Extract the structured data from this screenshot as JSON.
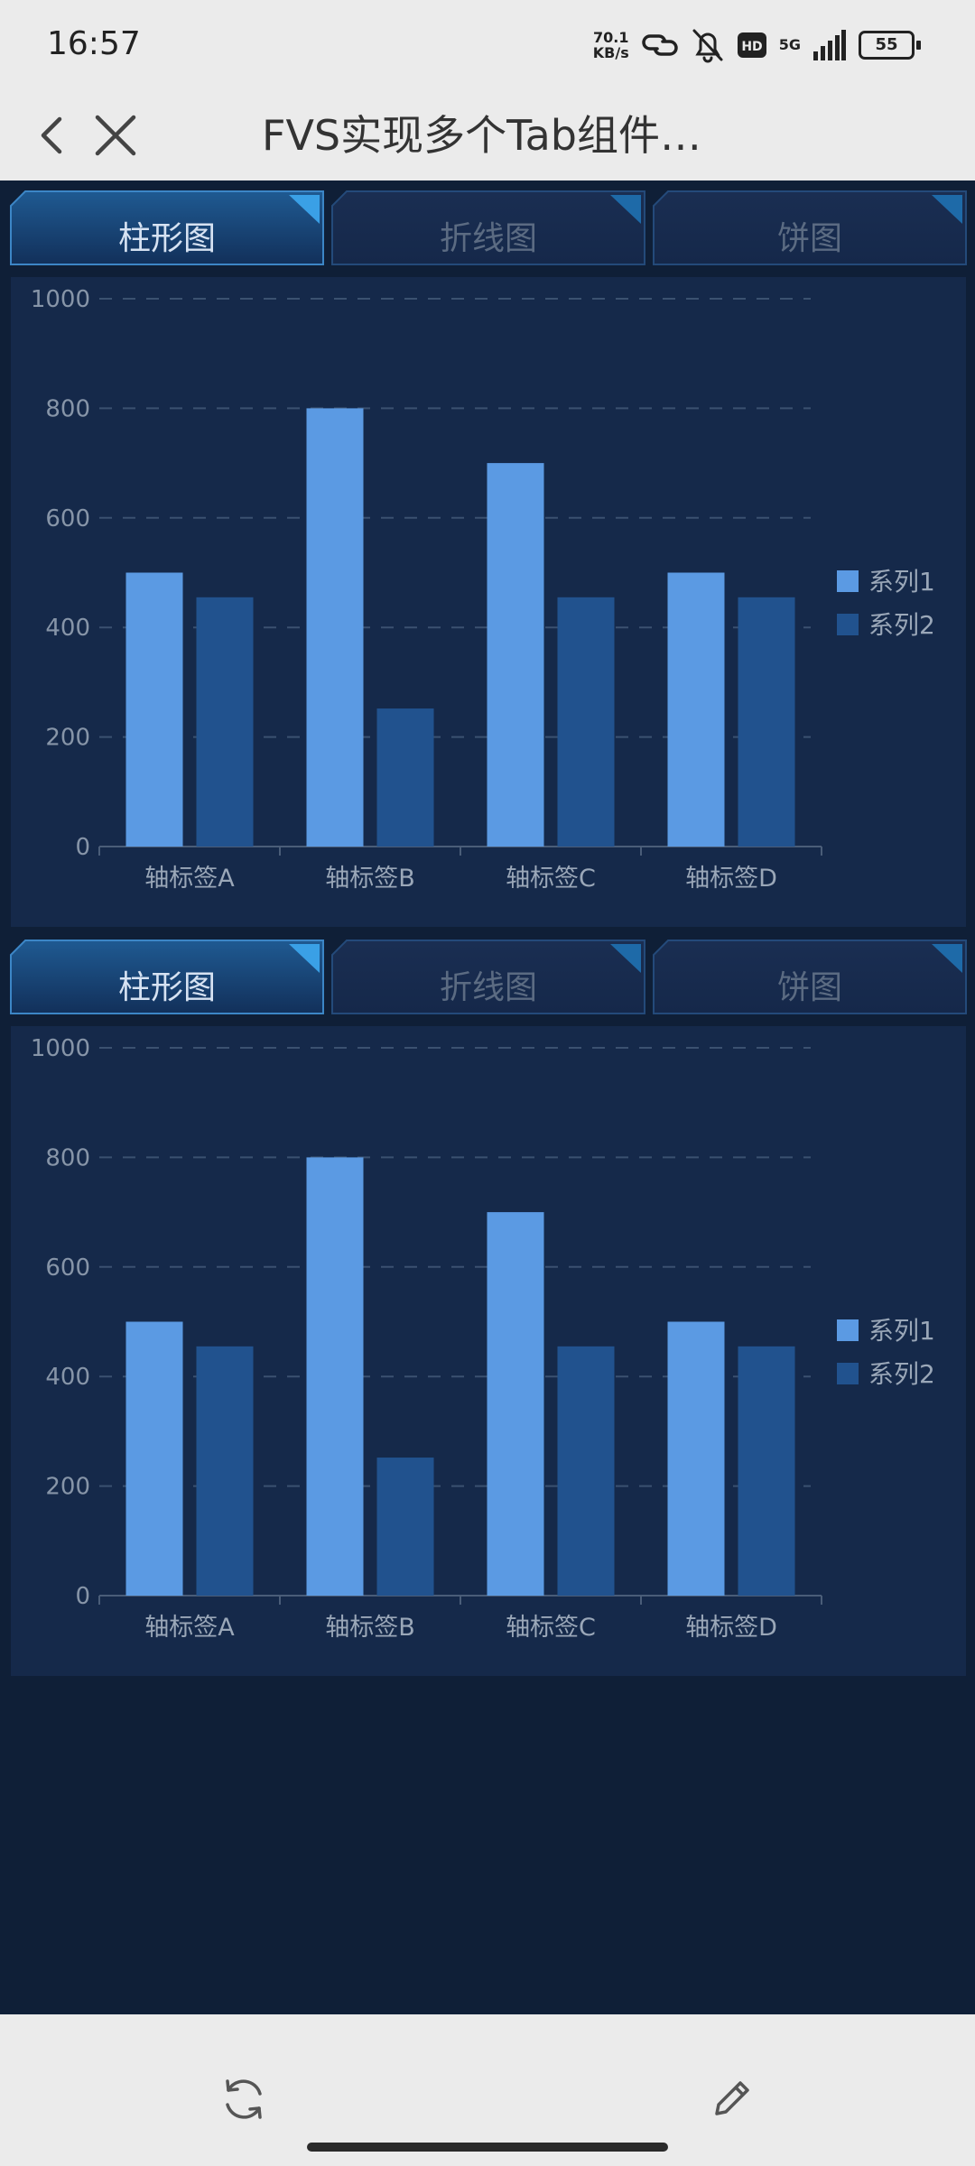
{
  "status_bar": {
    "time": "16:57",
    "net_speed_value": "70.1",
    "net_speed_unit": "KB/s",
    "network": "5G",
    "battery": "55",
    "icons": [
      "link-icon",
      "bell-off-icon",
      "hd-icon",
      "signal-icon",
      "battery-icon"
    ]
  },
  "nav": {
    "title": "FVS实现多个Tab组件…",
    "icons": [
      "back-icon",
      "close-icon"
    ]
  },
  "colors": {
    "series1": "#5b9ae3",
    "series2": "#21528e",
    "tab_active_text": "#d6e2f2",
    "tab_inactive_text": "#5b6b82",
    "panel_bg": "#15294a",
    "page_bg": "#0f1f37"
  },
  "widgets": [
    {
      "tabs": [
        {
          "label": "柱形图",
          "active": true
        },
        {
          "label": "折线图",
          "active": false
        },
        {
          "label": "饼图",
          "active": false
        }
      ]
    },
    {
      "tabs": [
        {
          "label": "柱形图",
          "active": true
        },
        {
          "label": "折线图",
          "active": false
        },
        {
          "label": "饼图",
          "active": false
        }
      ]
    }
  ],
  "chart_data": [
    {
      "type": "bar",
      "categories": [
        "轴标签A",
        "轴标签B",
        "轴标签C",
        "轴标签D"
      ],
      "series": [
        {
          "name": "系列1",
          "values": [
            500,
            800,
            700,
            500
          ]
        },
        {
          "name": "系列2",
          "values": [
            455,
            252,
            455,
            455
          ]
        }
      ],
      "ylim": [
        0,
        1000
      ],
      "yticks": [
        0,
        200,
        400,
        600,
        800,
        1000
      ],
      "grid": "dashed horizontal",
      "legend": "right"
    },
    {
      "type": "bar",
      "categories": [
        "轴标签A",
        "轴标签B",
        "轴标签C",
        "轴标签D"
      ],
      "series": [
        {
          "name": "系列1",
          "values": [
            500,
            800,
            700,
            500
          ]
        },
        {
          "name": "系列2",
          "values": [
            455,
            252,
            455,
            455
          ]
        }
      ],
      "ylim": [
        0,
        1000
      ],
      "yticks": [
        0,
        200,
        400,
        600,
        800,
        1000
      ],
      "grid": "dashed horizontal",
      "legend": "right"
    }
  ],
  "bottom_bar": {
    "icons": [
      "refresh-icon",
      "edit-icon"
    ]
  }
}
